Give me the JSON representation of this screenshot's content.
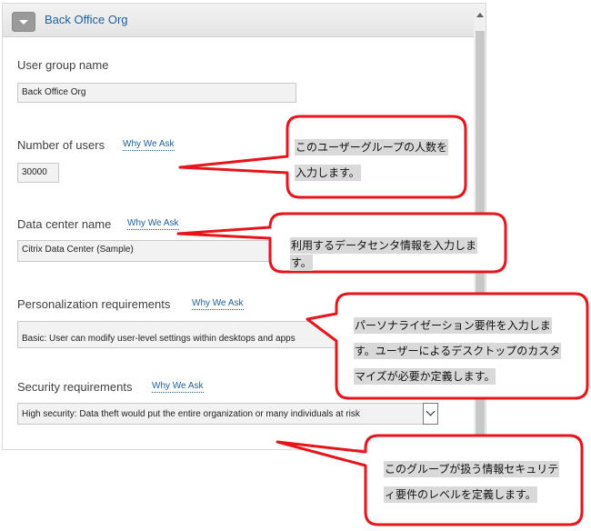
{
  "panel": {
    "title": "Back Office Org"
  },
  "form": {
    "user_group_name": {
      "label": "User group name",
      "value": "Back Office Org"
    },
    "number_of_users": {
      "label": "Number of users",
      "why": "Why We Ask",
      "value": "30000"
    },
    "data_center_name": {
      "label": "Data center name",
      "why": "Why We Ask",
      "value": "Citrix Data Center (Sample)"
    },
    "personalization": {
      "label": "Personalization requirements",
      "why": "Why We Ask",
      "value": "Basic: User can modify user-level settings within desktops and apps"
    },
    "security": {
      "label": "Security requirements",
      "why": "Why We Ask",
      "value": "High security: Data theft would put the entire organization or many individuals at risk"
    }
  },
  "annotations": {
    "users": [
      "このユーザーグループの人数を",
      "入力します。"
    ],
    "datacenter": [
      "利用するデータセンタ情報を入力しま",
      "す。"
    ],
    "personalization": [
      "パーソナライゼーション要件を入力しま",
      "す。ユーザーによるデスクトップのカスタ",
      "マイズが必要か定義します。"
    ],
    "security": [
      "このグループが扱う情報セキュリテ",
      "ィ要件のレベルを定義します。"
    ]
  },
  "colors": {
    "callout_border": "#e8141c",
    "link": "#1f5f9a"
  }
}
